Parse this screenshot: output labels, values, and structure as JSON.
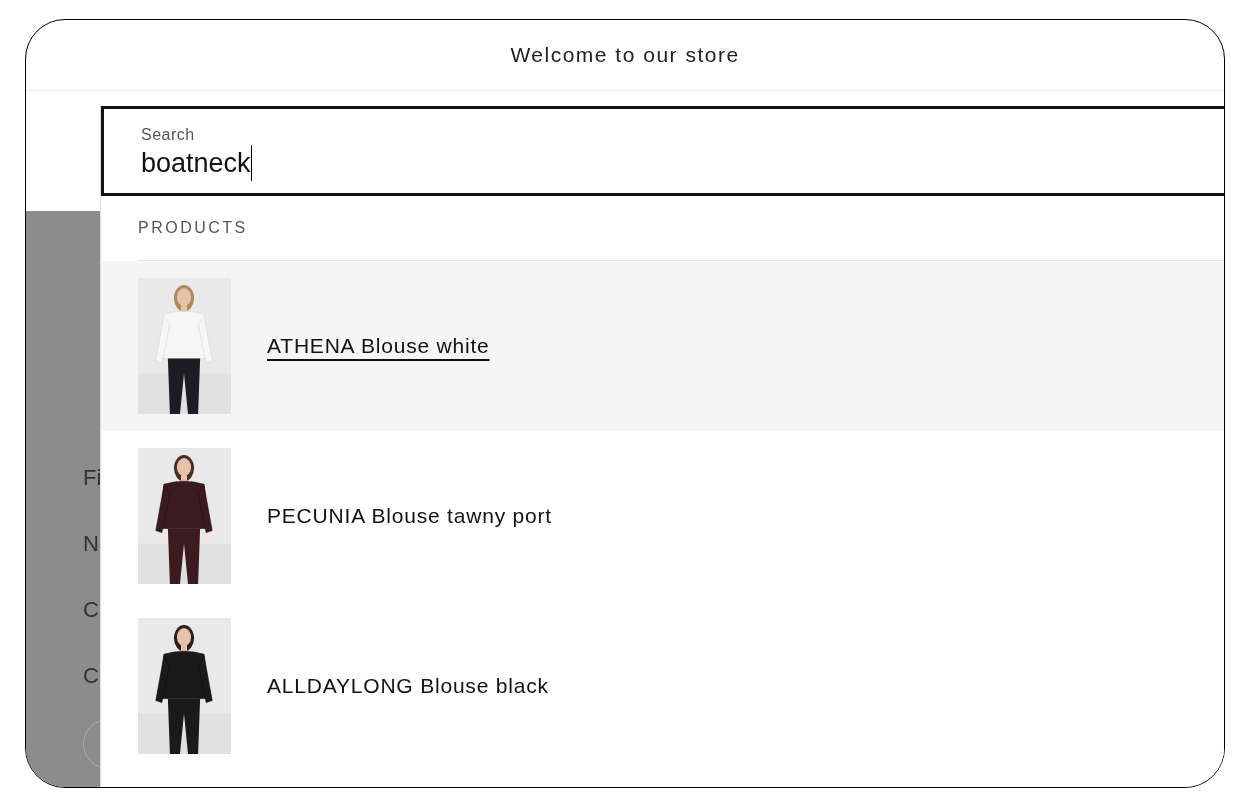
{
  "top_bar": {
    "text": "Welcome to our store"
  },
  "background_page": {
    "links": [
      "Fi",
      "N",
      "C",
      "C"
    ]
  },
  "search": {
    "label": "Search",
    "value": "boatneck"
  },
  "results": {
    "heading": "PRODUCTS",
    "products": [
      {
        "name": "ATHENA Blouse white",
        "selected": true
      },
      {
        "name": "PECUNIA Blouse tawny port",
        "selected": false
      },
      {
        "name": "ALLDAYLONG Blouse black",
        "selected": false
      }
    ]
  }
}
